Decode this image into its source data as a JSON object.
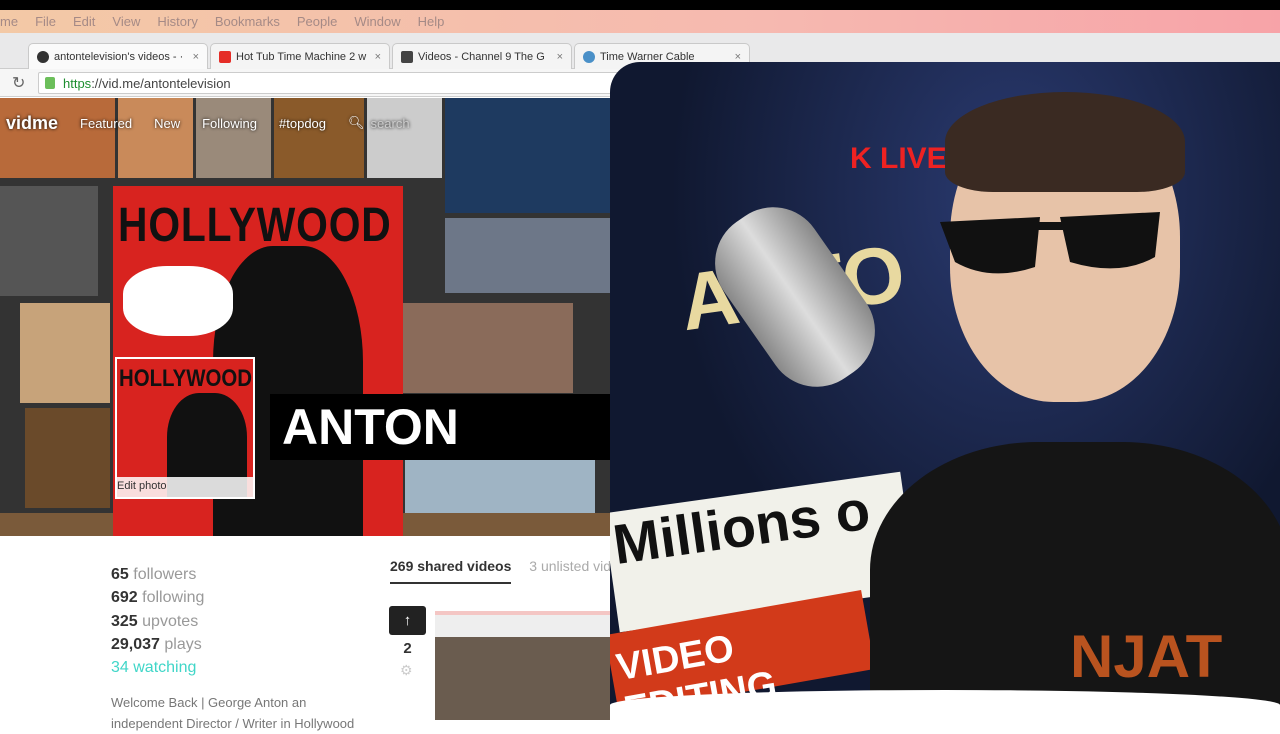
{
  "menubar": {
    "items": [
      "me",
      "File",
      "Edit",
      "View",
      "History",
      "Bookmarks",
      "People",
      "Window",
      "Help"
    ]
  },
  "tabs": [
    {
      "label": "antontelevision's videos - ·",
      "icon": "vidme-favicon",
      "active": true
    },
    {
      "label": "Hot Tub Time Machine 2 w",
      "icon": "youtube-favicon",
      "active": false
    },
    {
      "label": "Videos - Channel 9 The G",
      "icon": "channel9-favicon",
      "active": false
    },
    {
      "label": "Time Warner Cable",
      "icon": "twc-favicon",
      "active": false
    }
  ],
  "tab_close": "×",
  "address": {
    "scheme": "https",
    "rest": "://vid.me/antontelevision"
  },
  "vidme_nav": {
    "logo": "vidme",
    "items": [
      "Featured",
      "New",
      "Following",
      "#topdog"
    ],
    "search_placeholder": "search"
  },
  "profile": {
    "poster_text": "HOLLYWOOD",
    "avatar_text": "HOLLYWOOD",
    "edit_photo": "Edit photo",
    "name": "ANTON",
    "stats": [
      {
        "num": "65",
        "label": "followers"
      },
      {
        "num": "692",
        "label": "following"
      },
      {
        "num": "325",
        "label": "upvotes"
      },
      {
        "num": "29,037",
        "label": "plays"
      }
    ],
    "watching": "34 watching",
    "bio_line1": "Welcome Back | George Anton an",
    "bio_line2": "independent Director / Writer in Hollywood"
  },
  "video_tabs": {
    "shared": "269 shared videos",
    "unlisted": "3 unlisted vid"
  },
  "video": {
    "upvote_icon": "↑",
    "votes": "2"
  },
  "webcam": {
    "sign_live": "K LIVE",
    "sign_anton": "ANTO",
    "sign_millions": "Millions o",
    "sign_editing": "VIDEO EDITING",
    "shirt": "NJAT"
  }
}
